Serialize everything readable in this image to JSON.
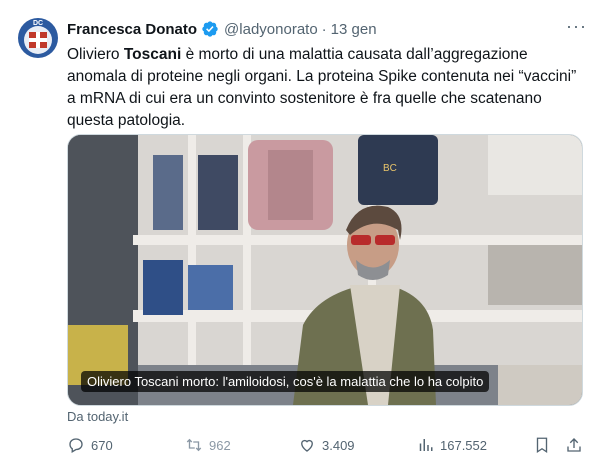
{
  "author": {
    "avatar_text": "DC",
    "name": "Francesca Donato",
    "handle": "@ladyonorato",
    "separator": "·",
    "time": "13 gen",
    "more_label": "···"
  },
  "tweet": {
    "text_segments": [
      "Oliviero ",
      "Toscani",
      " è morto di una malattia causata dall’aggregazione anomala di proteine negli organi. La proteina Spike contenuta nei “vaccini” a mRNA di cui era un convinto sostenitore è fra quelle che scatenano questa patologia."
    ]
  },
  "media": {
    "caption": "Oliviero Toscani morto: l'amiloidosi, cos'è la malattia che lo ha colpito",
    "jacket_logo": "BC"
  },
  "source": "Da today.it",
  "actions": {
    "replies": "670",
    "reposts": "962",
    "likes": "3.409",
    "views": "167.552"
  },
  "colors": {
    "verified": "#1d9bf0",
    "muted_text": "#536471",
    "link": "#1d9bf0"
  },
  "icons": [
    "verified-badge-icon",
    "more-icon",
    "reply-icon",
    "repost-icon",
    "like-icon",
    "views-icon",
    "bookmark-icon",
    "share-icon"
  ]
}
